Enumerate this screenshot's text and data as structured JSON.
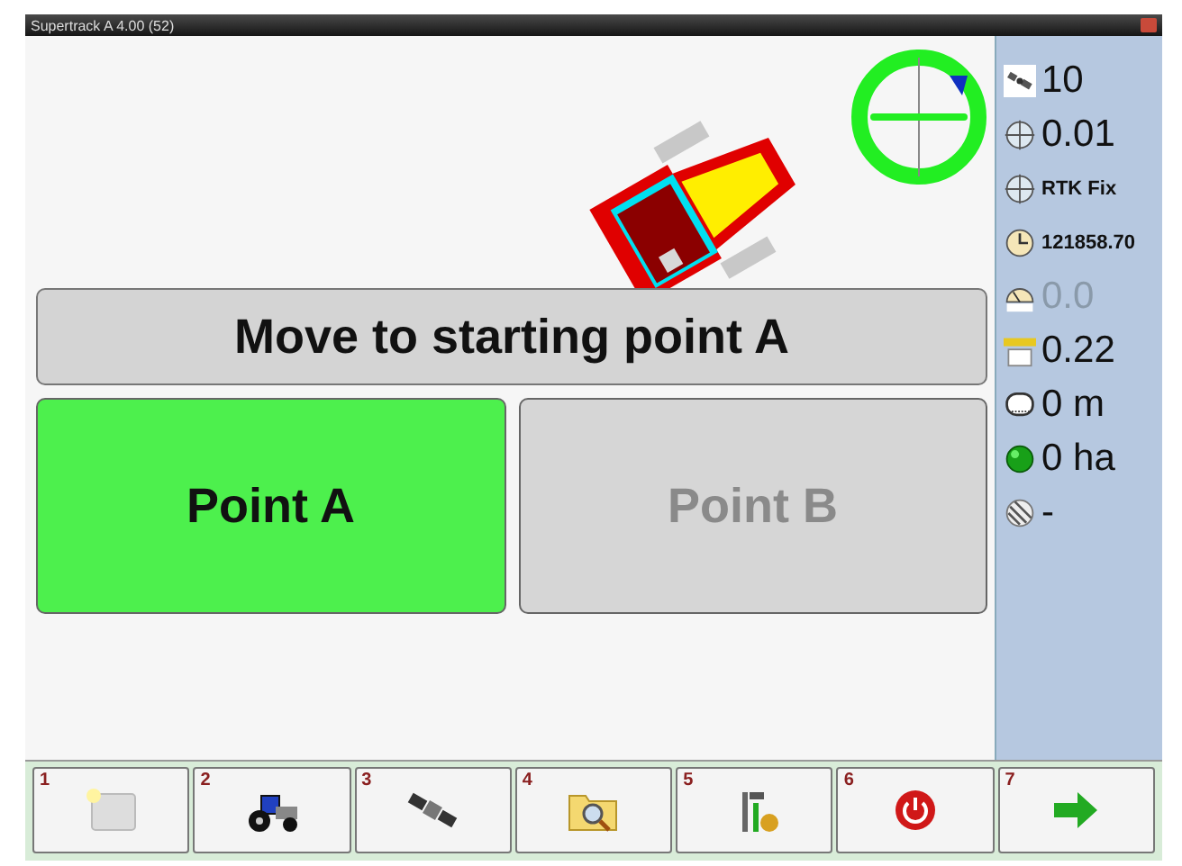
{
  "window": {
    "title": "Supertrack A 4.00 (52)"
  },
  "message": "Move to starting point A",
  "points": [
    {
      "label": "Point A",
      "disabled": false
    },
    {
      "label": "Point B",
      "disabled": true
    }
  ],
  "stats": [
    {
      "kind": "satellites",
      "value": "10",
      "dimmed": false
    },
    {
      "kind": "precision",
      "value": "0.01",
      "dimmed": false
    },
    {
      "kind": "fix",
      "value": "RTK Fix",
      "dimmed": false
    },
    {
      "kind": "time",
      "value": "121858.70",
      "dimmed": false
    },
    {
      "kind": "speed",
      "value": "0.0",
      "dimmed": true
    },
    {
      "kind": "width",
      "value": "0.22",
      "dimmed": false
    },
    {
      "kind": "distance",
      "value": "0 m",
      "dimmed": false
    },
    {
      "kind": "area",
      "value": "0 ha",
      "dimmed": false
    },
    {
      "kind": "pattern",
      "value": "-",
      "dimmed": false
    }
  ],
  "toolbar": [
    {
      "number": "1",
      "kind": "new"
    },
    {
      "number": "2",
      "kind": "tractor"
    },
    {
      "number": "3",
      "kind": "satellite"
    },
    {
      "number": "4",
      "kind": "search-folder"
    },
    {
      "number": "5",
      "kind": "tools"
    },
    {
      "number": "6",
      "kind": "power"
    },
    {
      "number": "7",
      "kind": "next"
    }
  ]
}
